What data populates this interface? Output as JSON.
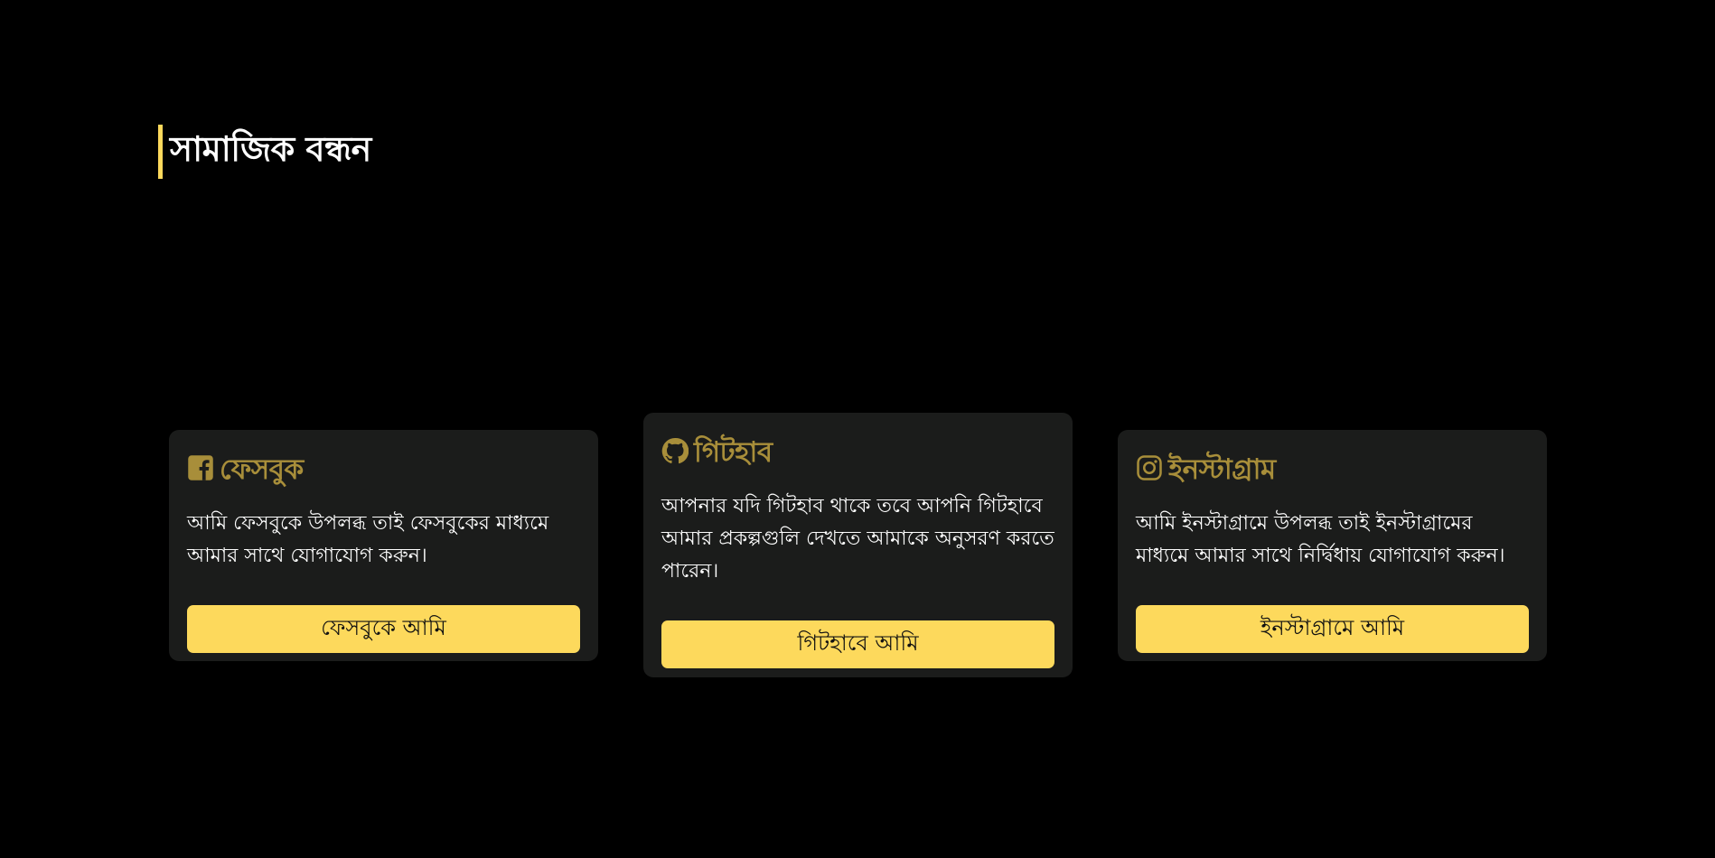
{
  "section": {
    "title": "সামাজিক বন্ধন"
  },
  "colors": {
    "background": "#000000",
    "card_background": "#1b1c1b",
    "accent": "#fdd95c",
    "heading": "#a88e3a"
  },
  "cards": [
    {
      "icon": "facebook-icon",
      "title": "ফেসবুক",
      "text": "আমি ফেসবুকে উপলব্ধ তাই ফেসবুকের মাধ্যমে আমার সাথে যোগাযোগ করুন।",
      "button": "ফেসবুকে আমি"
    },
    {
      "icon": "github-icon",
      "title": "গিটহাব",
      "text": "আপনার যদি গিটহাব থাকে তবে আপনি গিটহাবে আমার প্রকল্পগুলি দেখতে আমাকে অনুসরণ করতে পারেন।",
      "button": "গিটহাবে আমি"
    },
    {
      "icon": "instagram-icon",
      "title": "ইনস্টাগ্রাম",
      "text": "আমি ইনস্টাগ্রামে উপলব্ধ তাই ইনস্টাগ্রামের মাধ্যমে আমার সাথে নির্দ্বিধায় যোগাযোগ করুন।",
      "button": "ইনস্টাগ্রামে আমি"
    }
  ]
}
